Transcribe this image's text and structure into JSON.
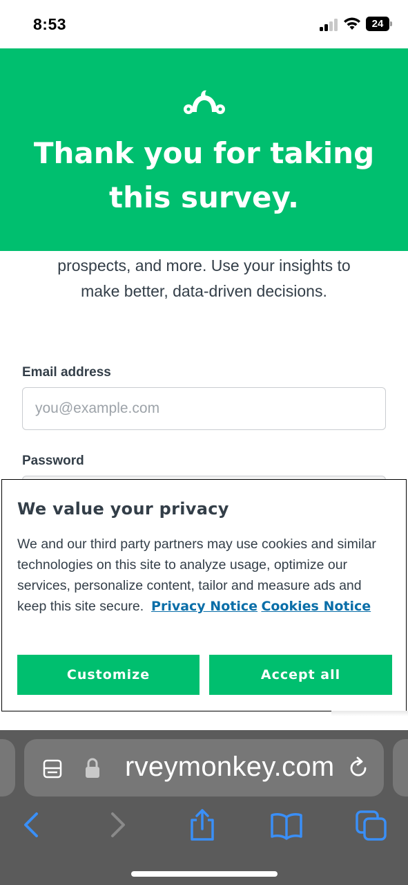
{
  "status_bar": {
    "time": "8:53",
    "battery": "24"
  },
  "header": {
    "title_line1": "Thank you for taking",
    "title_line2": "this survey.",
    "logo_icon": "surveymonkey-logo-icon"
  },
  "intro": {
    "line1": "prospects, and more. Use your insights to",
    "line2": "make better, data-driven decisions."
  },
  "form": {
    "email_label": "Email address",
    "email_placeholder": "you@example.com",
    "password_label": "Password"
  },
  "privacy": {
    "title": "We value your privacy",
    "body": "We and our third party partners may use cookies and similar technologies on this site to analyze usage, optimize our services, personalize content, tailor and measure ads and keep this site secure.",
    "privacy_link": "Privacy Notice",
    "cookies_link": "Cookies Notice",
    "customize_label": "Customize",
    "accept_label": "Accept all"
  },
  "browser": {
    "url": "rveymonkey.com"
  },
  "colors": {
    "brand_green": "#00bf6f",
    "link_blue": "#0a6ea8",
    "safari_blue": "#3a8ff7",
    "toolbar_gray": "#5b5b5b"
  }
}
